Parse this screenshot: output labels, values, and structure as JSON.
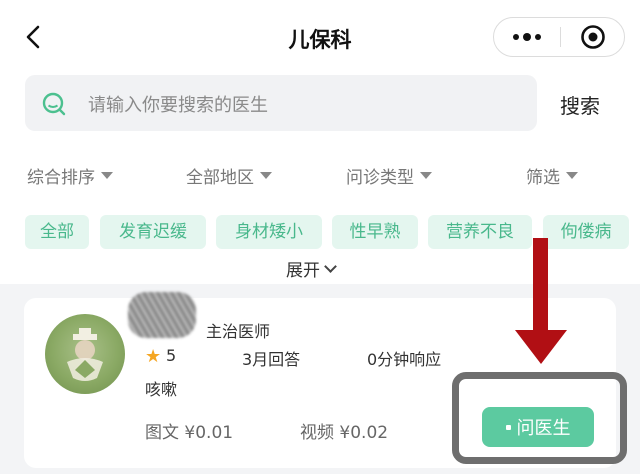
{
  "nav": {
    "title": "儿保科",
    "more_icon": "more-dots-icon",
    "close_icon": "target-close-icon"
  },
  "search": {
    "placeholder": "请输入你要搜索的医生",
    "button": "搜索"
  },
  "filters": [
    "综合排序",
    "全部地区",
    "问诊类型",
    "筛选"
  ],
  "tags": [
    "全部",
    "发育迟缓",
    "身材矮小",
    "性早熟",
    "营养不良",
    "佝偻病"
  ],
  "expand_label": "展开",
  "doctor": {
    "title": "主治医师",
    "rating": "5",
    "answers": "3月回答",
    "response": "0分钟响应",
    "specialty": "咳嗽",
    "price_text": "图文 ¥0.01",
    "price_video": "视频 ¥0.02",
    "ask_label": "问医生"
  },
  "colors": {
    "accent": "#5ccaa0",
    "tag_bg": "#e4f6ef",
    "tag_text": "#49b88c",
    "annotation_arrow": "#b10f14",
    "annotation_box": "#6e6e6e"
  }
}
